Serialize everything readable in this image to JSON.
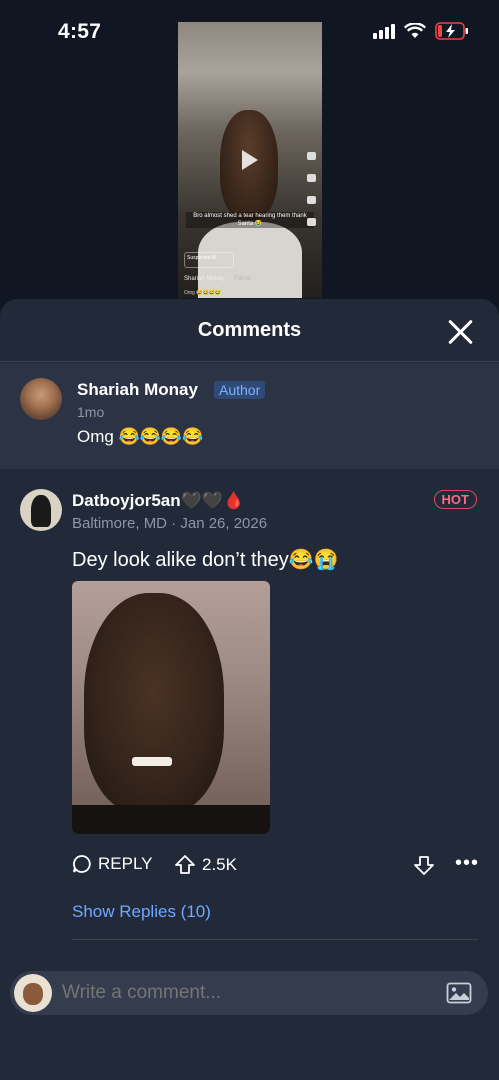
{
  "status_bar": {
    "time": "4:57"
  },
  "video": {
    "caption": "Bro almost shed a tear hearing them thank Santa 😭",
    "ai_tag": "Suspected AI",
    "username": "Shariah Monay",
    "follow": "Follow",
    "comment_preview": "Omg 😂😂😂😂"
  },
  "sheet": {
    "title": "Comments"
  },
  "pinned_comment": {
    "name": "Shariah Monay",
    "badge": "Author",
    "meta": "1mo",
    "text": "Omg 😂😂😂😂"
  },
  "comment": {
    "name": "Datboyjor5an🖤🖤🩸",
    "meta": "Baltimore, MD · Jan 26, 2026",
    "badge": "HOT",
    "text": "Dey look alike don’t they😂😭",
    "reply_label": "REPLY",
    "upvote_count": "2.5K",
    "show_replies": "Show Replies (10)"
  },
  "composer": {
    "placeholder": "Write a comment..."
  },
  "colors": {
    "background": "#111722",
    "sheet": "#222a3a",
    "accent": "#6ea8ff",
    "hot": "#e0475e"
  }
}
